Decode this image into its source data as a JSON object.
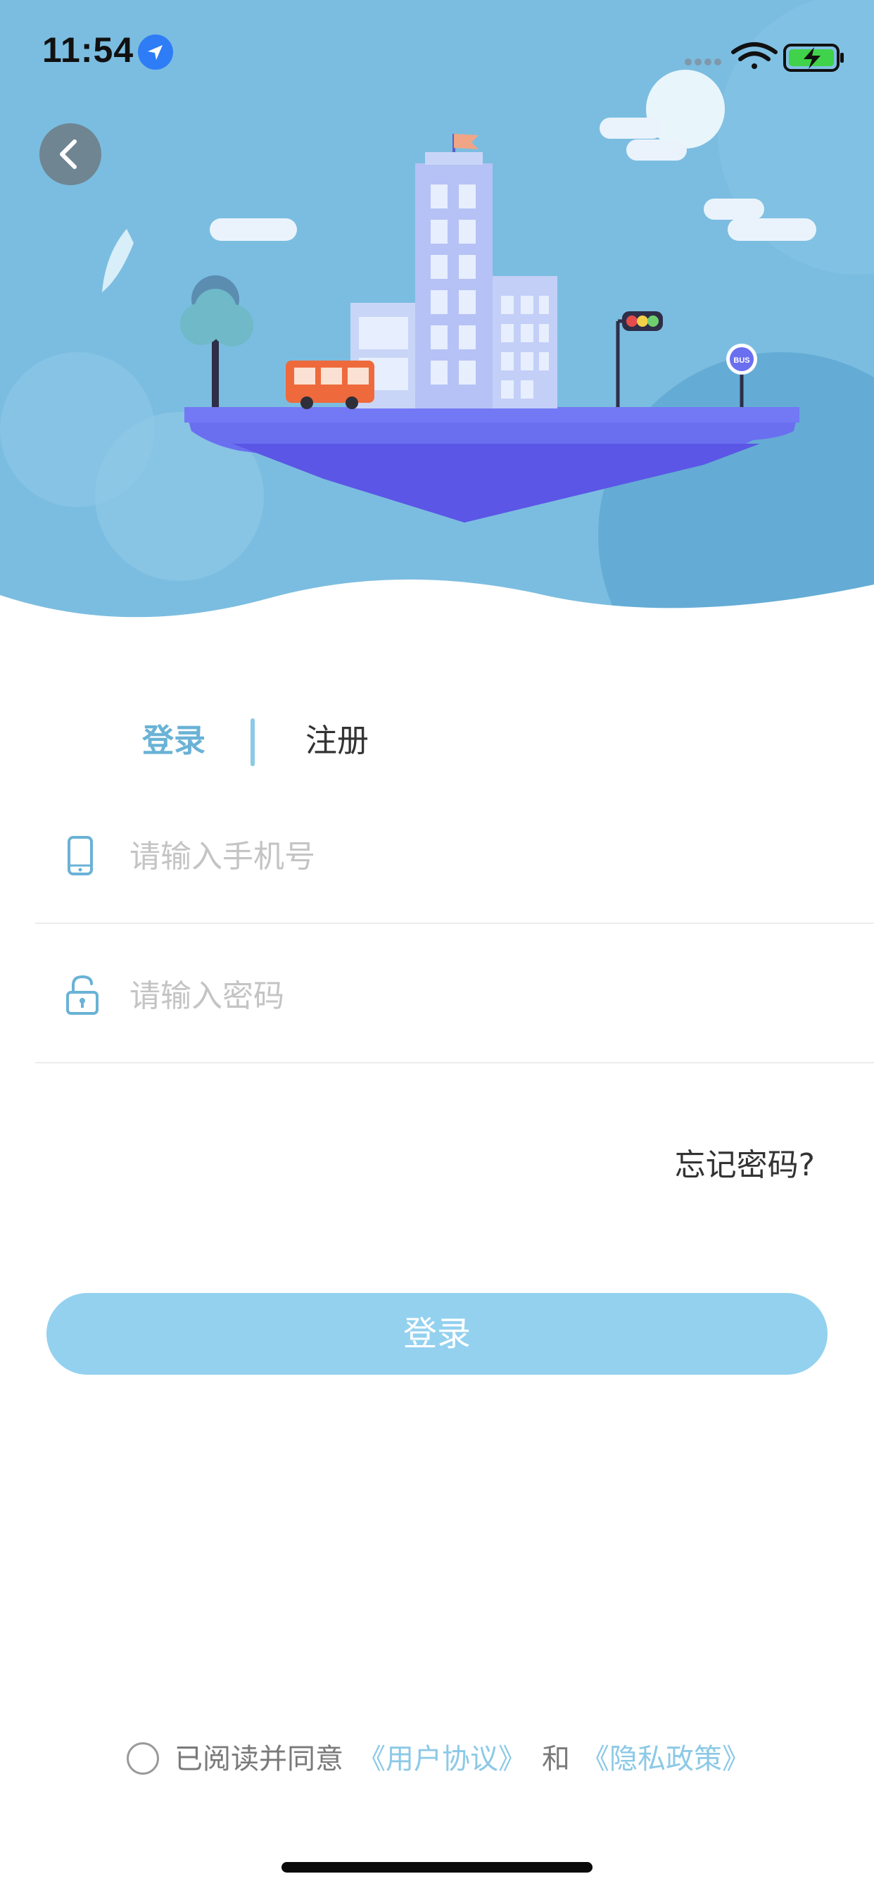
{
  "status_bar": {
    "time": "11:54",
    "location_icon": "location-arrow-icon",
    "signal_icon": "cellular-signal-icon",
    "wifi_icon": "wifi-icon",
    "battery_icon": "battery-charging-icon"
  },
  "header": {
    "back_icon": "chevron-left-icon",
    "illustration": "floating-city-island-illustration",
    "bus_sign_text": "BUS"
  },
  "tabs": {
    "login_label": "登录",
    "register_label": "注册",
    "active": "login"
  },
  "form": {
    "phone": {
      "placeholder": "请输入手机号",
      "value": "",
      "icon": "mobile-phone-icon"
    },
    "password": {
      "placeholder": "请输入密码",
      "value": "",
      "icon": "unlock-icon"
    },
    "forgot_label": "忘记密码?",
    "submit_label": "登录"
  },
  "agreement": {
    "prefix": "已阅读并同意",
    "user_agreement": "《用户协议》",
    "conjunction": "和",
    "privacy_policy": "《隐私政策》",
    "checked": false
  },
  "colors": {
    "accent": "#6ab2d6",
    "button": "#93d1ef",
    "link": "#8cc9e6",
    "sky": "#7bbde0"
  }
}
